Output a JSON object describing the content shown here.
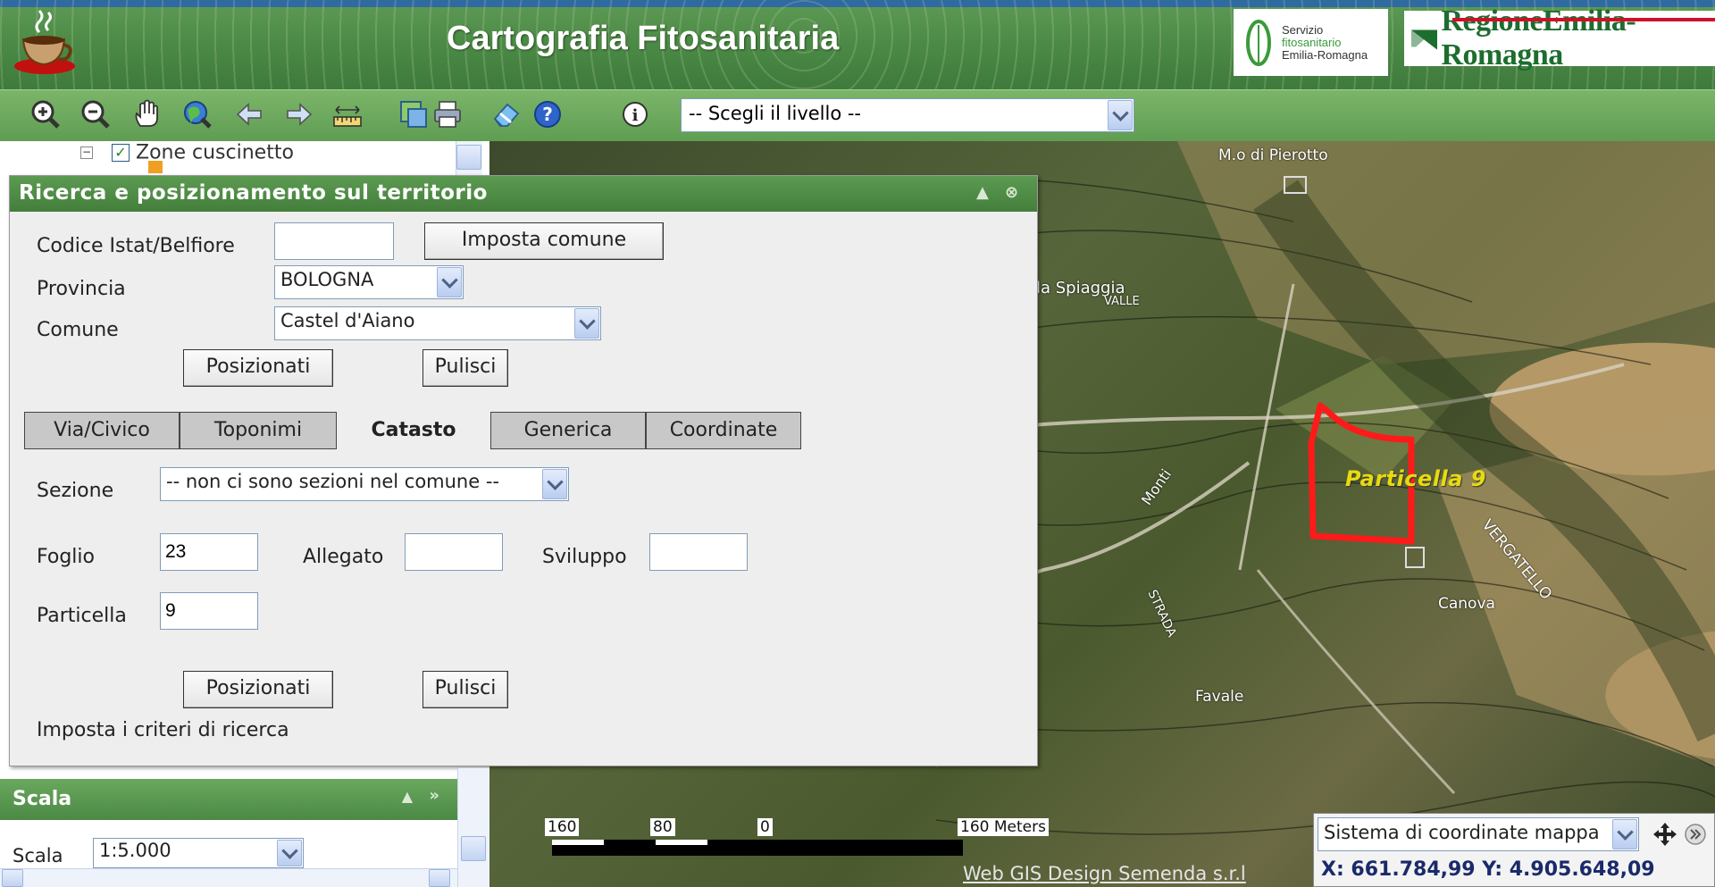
{
  "header": {
    "title": "Cartografia Fitosanitaria",
    "servizio_logo": {
      "line1": "Servizio",
      "line2": "fitosanitario",
      "line3": "Emilia-Romagna"
    },
    "regione_logo": "RegioneEmilia-Romagna"
  },
  "toolbar": {
    "icons": [
      "zoom-in-icon",
      "zoom-out-icon",
      "pan-hand-icon",
      "full-extent-globe-icon",
      "back-arrow-icon",
      "forward-arrow-icon",
      "measure-ruler-icon",
      "map-layers-icon",
      "print-icon",
      "eraser-icon",
      "help-icon",
      "info-icon"
    ],
    "layer_select": "-- Scegli il livello --"
  },
  "left_panel": {
    "tree_item": "Zone cuscinetto"
  },
  "search_dialog": {
    "title": "Ricerca e posizionamento sul territorio",
    "codice_label": "Codice Istat/Belfiore",
    "codice_value": "",
    "imposta_comune_button": "Imposta comune",
    "provincia_label": "Provincia",
    "provincia_value": "BOLOGNA",
    "comune_label": "Comune",
    "comune_value": "Castel d'Aiano",
    "posizionati_button": "Posizionati",
    "pulisci_button": "Pulisci",
    "tabs": [
      "Via/Civico",
      "Toponimi",
      "Catasto",
      "Generica",
      "Coordinate"
    ],
    "active_tab": "Catasto",
    "sezione_label": "Sezione",
    "sezione_value": "-- non ci sono sezioni nel comune --",
    "foglio_label": "Foglio",
    "foglio_value": "23",
    "allegato_label": "Allegato",
    "allegato_value": "",
    "sviluppo_label": "Sviluppo",
    "sviluppo_value": "",
    "particella_label": "Particella",
    "particella_value": "9",
    "posizionati_button_2": "Posizionati",
    "pulisci_button_2": "Pulisci",
    "status": "Imposta i criteri di ricerca"
  },
  "scala_panel": {
    "title": "Scala",
    "label": "Scala",
    "value": "1:5.000"
  },
  "map": {
    "labels": [
      "M.o di Pierotto",
      "la Spiaggia",
      "Particella 9",
      "VERGATELLO",
      "Canova",
      "Favale",
      "Monti",
      "STRADA",
      "VALLE"
    ],
    "scale_labels": [
      "160",
      "80",
      "0",
      "160 Meters"
    ]
  },
  "footer": {
    "credits": "Web GIS Design Semenda s.r.l",
    "coord_system": "Sistema di coordinate mappa",
    "coord_readout": "X: 661.784,99 Y: 4.905.648,09"
  },
  "colors": {
    "header_green": "#4b8a46",
    "dialog_title_green": "#4f8c47",
    "parcel_red": "#ff1a1a",
    "parcel_label_yellow": "#d6c300"
  }
}
